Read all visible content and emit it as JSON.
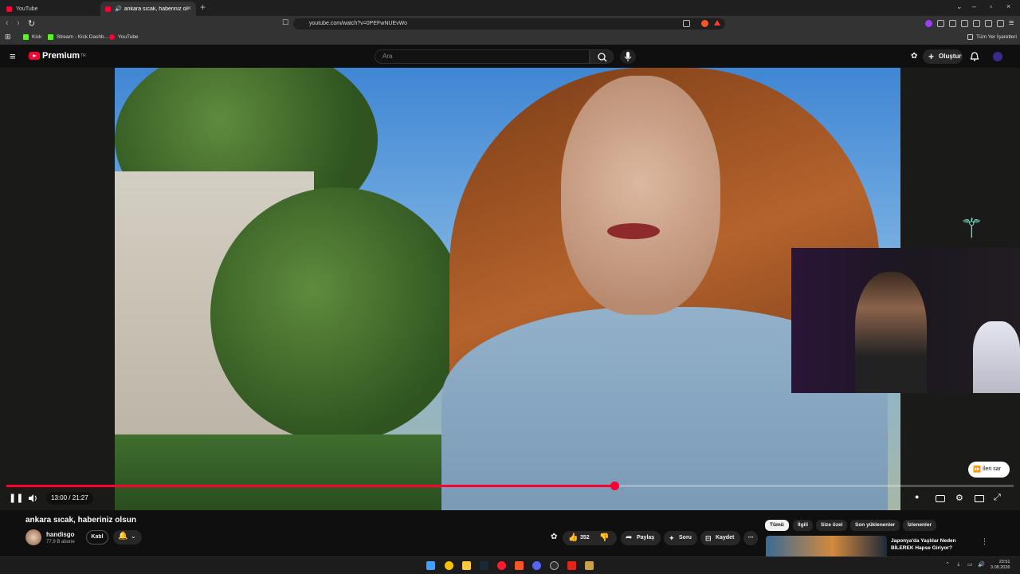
{
  "browser": {
    "tabs": [
      {
        "label": "YouTube",
        "active": false
      },
      {
        "label": "ankara sıcak, haberiniz olsun",
        "active": true
      }
    ],
    "url": "youtube.com/watch?v=0PEFwNUEvWo",
    "bookmarks": [
      "Kick",
      "Stream - Kick Dashb...",
      "YouTube"
    ],
    "all_bookmarks_label": "Tüm Yer İşaretleri"
  },
  "header": {
    "logo_text": "Premium",
    "logo_badge": "TR",
    "search_placeholder": "Ara",
    "create_label": "Oluştur"
  },
  "player": {
    "current_time": "13:00 / 21:27",
    "progress_fraction": 0.604,
    "skip_label": "İleri sar"
  },
  "video": {
    "title": "ankara sıcak, haberiniz olsun",
    "channel": "handisgo",
    "subscribers": "77,9 B abone",
    "join_label": "Katıl",
    "likes": "352",
    "share_label": "Paylaş",
    "ask_label": "Soru",
    "save_label": "Kaydet"
  },
  "chips": [
    "Tümü",
    "İlgili",
    "Size özel",
    "Son yüklenenler",
    "İzlenenler"
  ],
  "recommendation": {
    "title": "Japonya'da Yaşlılar Neden BİLEREK Hapse Giriyor?"
  },
  "taskbar": {
    "time": "23:51",
    "date": "3.08.2026"
  },
  "colors": {
    "accent": "#ff0033",
    "background": "#0f0f0f"
  }
}
